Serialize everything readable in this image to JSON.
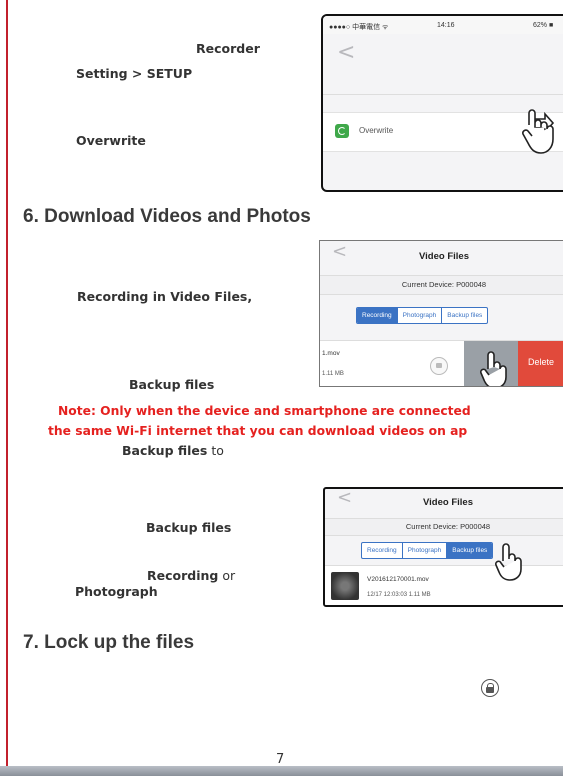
{
  "page": {
    "number": "7"
  },
  "section1": {
    "line1": "Recorder",
    "line2": "Setting > SETUP",
    "line3": "Overwrite"
  },
  "screen1": {
    "status_carrier": "●●●●○ 中華電信 ᯤ",
    "status_time": "14:16",
    "status_battery": "62% ■",
    "back": "<",
    "row_label": "Overwrite"
  },
  "section6": {
    "heading": "6. Download Videos and Photos",
    "text1": "Recording in Video Files,",
    "text2": "Backup files",
    "note_line1": "Note: Only when the device and smartphone are connected",
    "note_line2": "the same Wi-Fi internet that you can download videos on ap",
    "text3_bold": "Backup files",
    "text3_rest": " to",
    "text4": "Backup files",
    "text5_bold": "Recording",
    "text5_rest": " or",
    "text6": "Photograph"
  },
  "screen2": {
    "back": "<",
    "title": "Video Files",
    "device": "Current Device: P000048",
    "tabs": [
      "Recording",
      "Photograph",
      "Backup files"
    ],
    "file_name": "1.mov",
    "file_size": "1.11 MB",
    "delete_label": "Delete"
  },
  "screen3": {
    "back": "<",
    "title": "Video Files",
    "device": "Current Device: P000048",
    "tabs": [
      "Recording",
      "Photograph",
      "Backup files"
    ],
    "file_name": "V201612170001.mov",
    "file_meta": "12/17 12:03:03  1.11 MB"
  },
  "section7": {
    "heading": "7. Lock up the files"
  },
  "colors": {
    "accent_red": "#e5211f",
    "tab_blue": "#3b73c4",
    "delete_red": "#e14a3b"
  }
}
